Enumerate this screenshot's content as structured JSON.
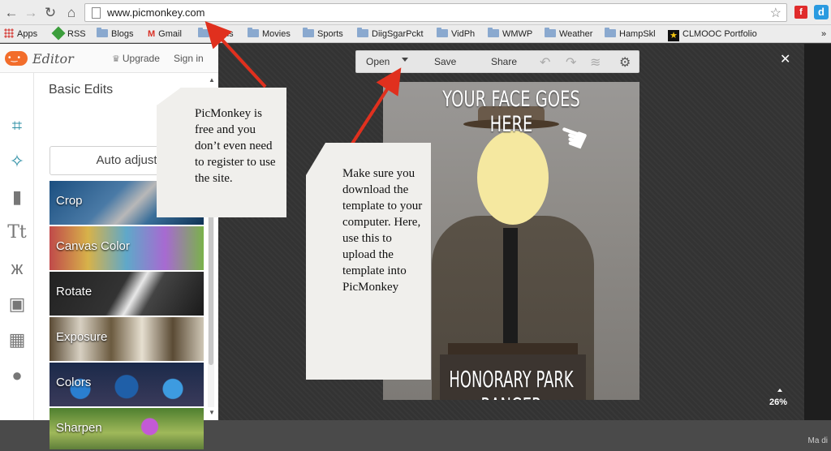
{
  "browser": {
    "url": "www.picmonkey.com",
    "bookmarks": [
      {
        "label": "Apps",
        "icon": "apps-grid-icon"
      },
      {
        "label": "RSS",
        "icon": "rss-icon"
      },
      {
        "label": "Blogs",
        "icon": "folder-icon"
      },
      {
        "label": "Gmail",
        "icon": "gmail-icon"
      },
      {
        "label": "Tools",
        "icon": "folder-icon"
      },
      {
        "label": "Movies",
        "icon": "folder-icon"
      },
      {
        "label": "Sports",
        "icon": "folder-icon"
      },
      {
        "label": "DiigSgarPckt",
        "icon": "folder-icon"
      },
      {
        "label": "VidPh",
        "icon": "folder-icon"
      },
      {
        "label": "WMWP",
        "icon": "folder-icon"
      },
      {
        "label": "Weather",
        "icon": "folder-icon"
      },
      {
        "label": "HampSkl",
        "icon": "folder-icon"
      },
      {
        "label": "CLMOOC Portfolio",
        "icon": "clmooc-icon"
      }
    ],
    "more_glyph": "»"
  },
  "app": {
    "logo_text": "Editor",
    "upgrade_label": "Upgrade",
    "signin_label": "Sign in",
    "section_title": "Basic Edits",
    "auto_adjust_label": "Auto adjust",
    "edits": [
      {
        "label": "Crop"
      },
      {
        "label": "Canvas Color"
      },
      {
        "label": "Rotate"
      },
      {
        "label": "Exposure"
      },
      {
        "label": "Colors"
      },
      {
        "label": "Sharpen"
      }
    ],
    "tool_rail": [
      "crop-icon",
      "magic-wand-icon",
      "lipstick-icon",
      "text-icon",
      "butterfly-icon",
      "frame-icon",
      "texture-icon",
      "apple-icon"
    ]
  },
  "toolbar": {
    "open_label": "Open",
    "save_label": "Save",
    "share_label": "Share"
  },
  "photo": {
    "title": "YOUR FACE GOES HERE",
    "caption": "HONORARY PARK RANGER"
  },
  "zoom": "26%",
  "notes": {
    "note1": "PicMonkey is free and you don’t even need to register to use the site.",
    "note2": "Make sure you download the template to your computer. Here, use this to upload the template into PicMonkey"
  },
  "bottom_corner": "Ma di",
  "colors": {
    "accent": "#2e8fa5",
    "brand_orange": "#f26d2b",
    "arrow_red": "#e0301e",
    "face_fill": "#f5e8a0"
  }
}
